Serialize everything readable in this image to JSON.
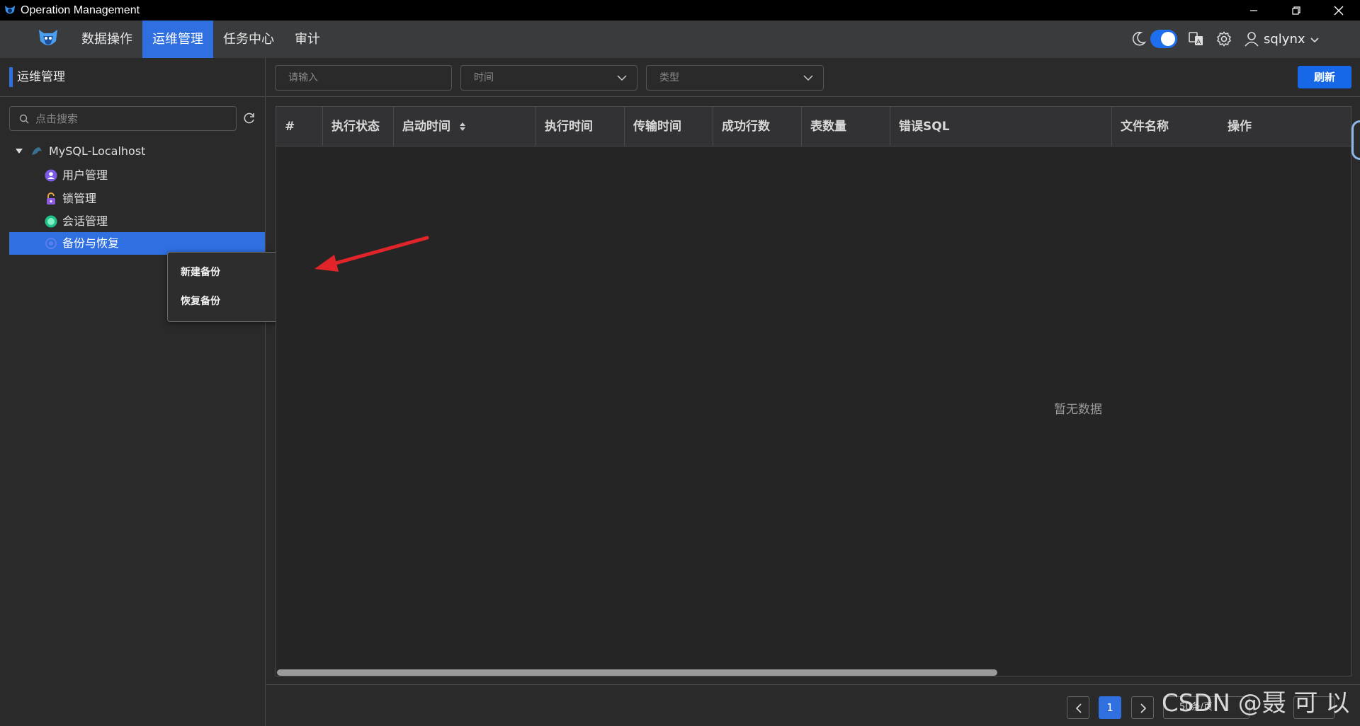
{
  "window": {
    "title": "Operation Management"
  },
  "nav": {
    "items": [
      {
        "label": "数据操作"
      },
      {
        "label": "运维管理"
      },
      {
        "label": "任务中心"
      },
      {
        "label": "审计"
      }
    ],
    "username": "sqlynx",
    "theme_toggle_on": true
  },
  "left_panel": {
    "title": "运维管理",
    "search_placeholder": "点击搜索",
    "tree": {
      "root": "MySQL-Localhost",
      "children": [
        {
          "label": "用户管理",
          "icon": "user-manage-icon"
        },
        {
          "label": "锁管理",
          "icon": "lock-icon"
        },
        {
          "label": "会话管理",
          "icon": "session-icon"
        },
        {
          "label": "备份与恢复",
          "icon": "backup-icon"
        }
      ]
    }
  },
  "context_menu": {
    "items": [
      {
        "label": "新建备份"
      },
      {
        "label": "恢复备份"
      }
    ]
  },
  "filters": {
    "input_placeholder": "请输入",
    "time_placeholder": "时间",
    "type_placeholder": "类型",
    "refresh_label": "刷新"
  },
  "table": {
    "columns": [
      "#",
      "执行状态",
      "启动时间",
      "执行时间",
      "传输时间",
      "成功行数",
      "表数量",
      "错误SQL",
      "文件名称",
      "操作"
    ],
    "rows": [],
    "empty_text": "暂无数据"
  },
  "pagination": {
    "current_page": "1",
    "page_size_text": "50条/页"
  },
  "watermark": "CSDN @聂 可 以",
  "colors": {
    "accent": "#2f6fe0",
    "annotation_arrow": "#e0242a"
  }
}
